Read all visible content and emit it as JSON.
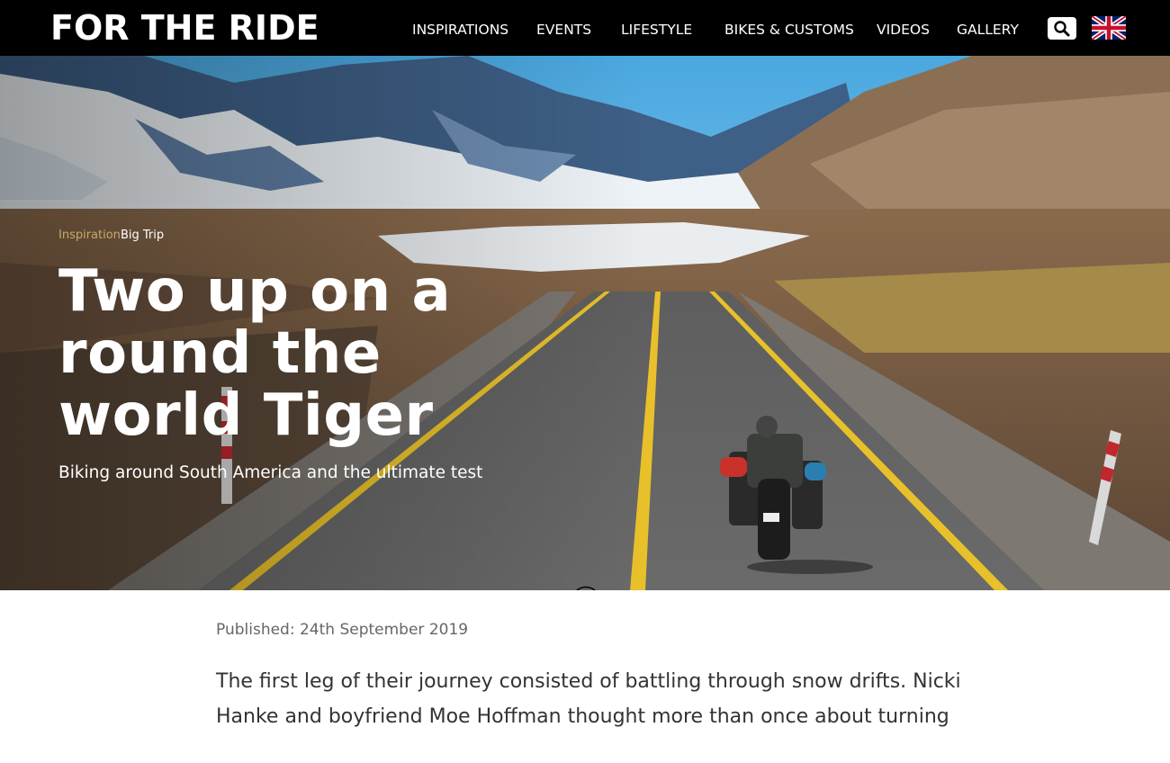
{
  "header": {
    "logo": "FOR THE RIDE",
    "nav": [
      "INSPIRATIONS",
      "EVENTS",
      "LIFESTYLE",
      "BIKES & CUSTOMS",
      "VIDEOS",
      "GALLERY"
    ],
    "search_icon": "search-icon",
    "language_icon": "uk-flag-icon"
  },
  "hero": {
    "breadcrumb": [
      "Inspiration",
      "Big Trip"
    ],
    "title": "Two up on a round the world Tiger",
    "subtitle": "Biking around South America and the ultimate test",
    "scroll_icon": "arrow-down-circle-icon"
  },
  "article": {
    "published": "Published: 24th September 2019",
    "intro": "The first leg of their journey consisted of battling through snow drifts. Nicki Hanke and boyfriend Moe Hoffman thought more than once about turning"
  },
  "colors": {
    "header_bg": "#000000",
    "breadcrumb_accent": "#c8a96a",
    "road_line": "#e8c02a"
  }
}
